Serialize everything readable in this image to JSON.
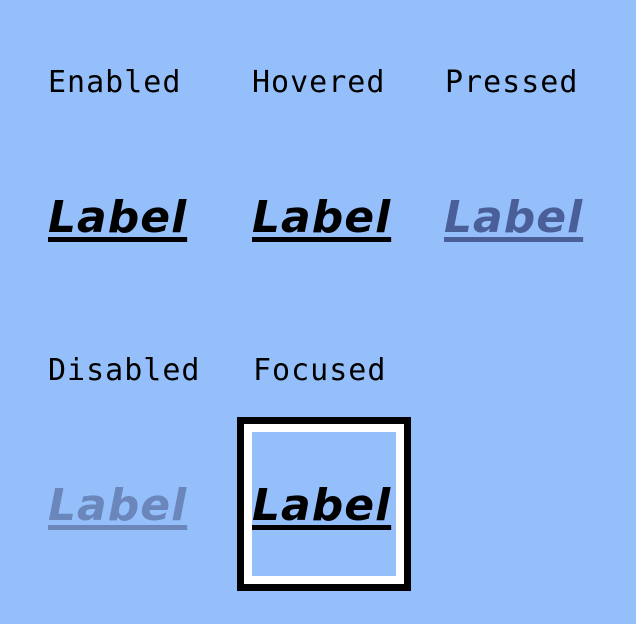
{
  "states": {
    "enabled": {
      "caption": "Enabled",
      "link_text": "Label"
    },
    "hovered": {
      "caption": "Hovered",
      "link_text": "Label"
    },
    "pressed": {
      "caption": "Pressed",
      "link_text": "Label"
    },
    "disabled": {
      "caption": "Disabled",
      "link_text": "Label"
    },
    "focused": {
      "caption": "Focused",
      "link_text": "Label"
    }
  },
  "colors": {
    "background": "#94bffa",
    "text": "#000000",
    "pressed_text": "#4a5f98",
    "disabled_text": "#6a86bb",
    "focus_ring_outer": "#000000",
    "focus_ring_inner": "#ffffff"
  }
}
